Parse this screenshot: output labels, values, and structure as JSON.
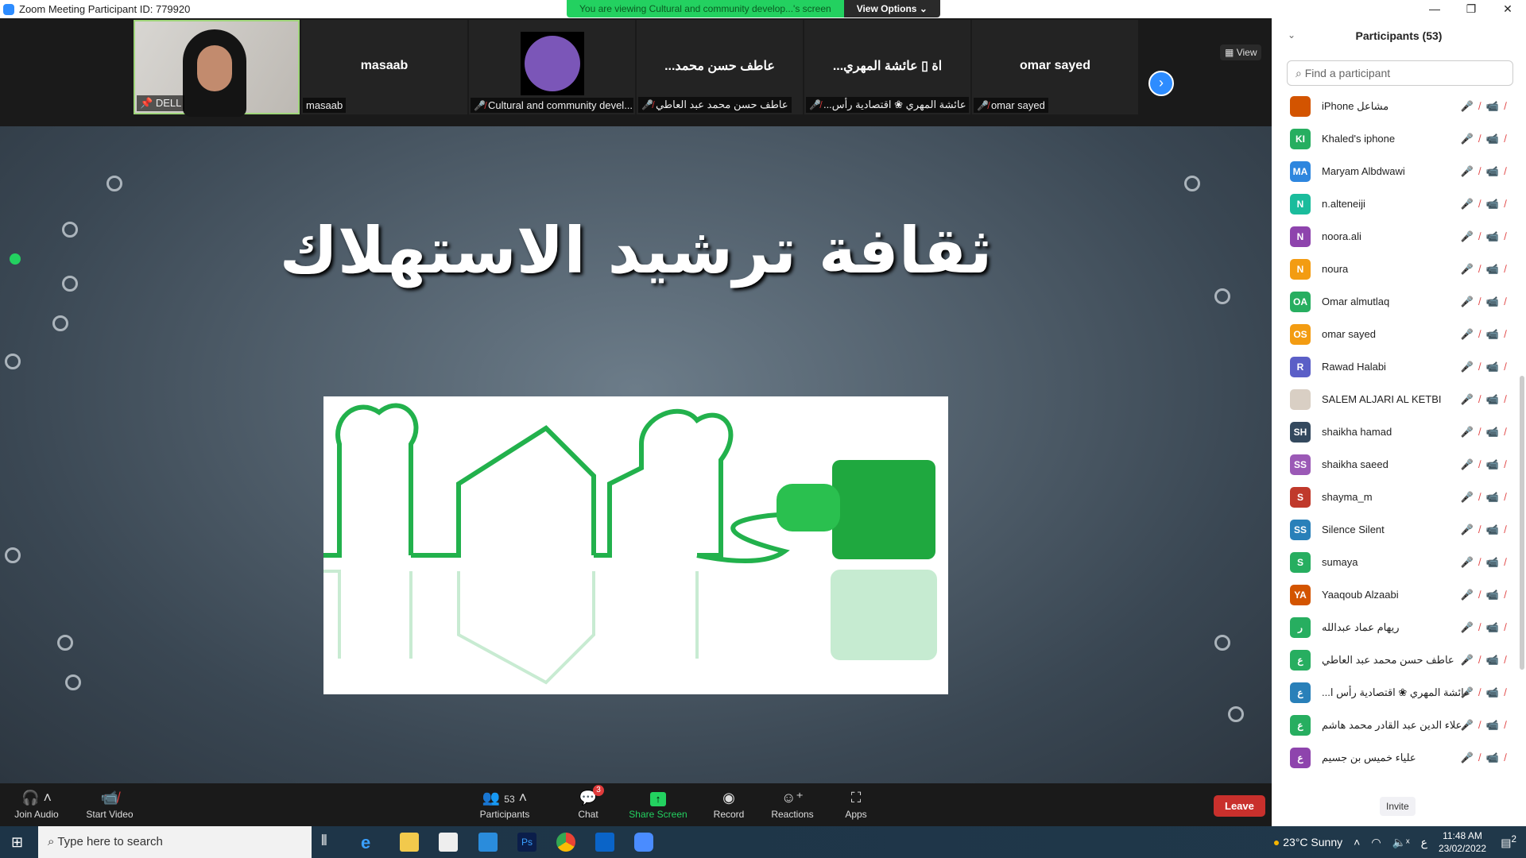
{
  "window": {
    "title": "Zoom Meeting Participant ID: 779920",
    "controls": [
      "—",
      "❐",
      "✕"
    ]
  },
  "banner": {
    "viewing": "You are viewing Cultural and community develop...'s screen",
    "view_options": "View Options ⌄"
  },
  "strip": {
    "view_label": "View",
    "tiles": [
      {
        "name": "",
        "label": "DELL",
        "type": "video"
      },
      {
        "name": "masaab",
        "label": "masaab"
      },
      {
        "name": "",
        "label": "Cultural and community devel...",
        "type": "logo",
        "muted": true
      },
      {
        "name": "...عاطف حسن محمد",
        "label": "عاطف حسن محمد عبد العاطي",
        "muted": true
      },
      {
        "name": "...اة ▯ عائشة المهري",
        "label": "...عائشة المهري ❀ اقتصادية رأس",
        "muted": true
      },
      {
        "name": "omar sayed",
        "label": "omar sayed",
        "muted": true
      }
    ]
  },
  "slide": {
    "title": "ثقافة ترشيد الاستهلاك"
  },
  "toolbar": {
    "join_audio": "Join Audio",
    "start_video": "Start Video",
    "participants": "Participants",
    "participants_count": "53",
    "chat": "Chat",
    "chat_badge": "3",
    "share": "Share Screen",
    "record": "Record",
    "reactions": "Reactions",
    "apps": "Apps",
    "leave": "Leave",
    "share_color": "#23d160"
  },
  "panel": {
    "title": "Participants (53)",
    "search_placeholder": "Find a participant",
    "invite": "Invite",
    "participants": [
      {
        "initials": "",
        "name": "iPhone مشاعل",
        "color": "#d35400"
      },
      {
        "initials": "KI",
        "name": "Khaled's iphone",
        "color": "#27ae60"
      },
      {
        "initials": "MA",
        "name": "Maryam Albdwawi",
        "color": "#2e86de"
      },
      {
        "initials": "N",
        "name": "n.alteneiji",
        "color": "#1abc9c"
      },
      {
        "initials": "N",
        "name": "noora.ali",
        "color": "#8e44ad"
      },
      {
        "initials": "N",
        "name": "noura",
        "color": "#f39c12"
      },
      {
        "initials": "OA",
        "name": "Omar almutlaq",
        "color": "#27ae60"
      },
      {
        "initials": "OS",
        "name": "omar sayed",
        "color": "#f39c12"
      },
      {
        "initials": "R",
        "name": "Rawad Halabi",
        "color": "#5b5fc7"
      },
      {
        "initials": "",
        "name": "SALEM ALJARI AL KETBI",
        "color": "#d9cfc4"
      },
      {
        "initials": "SH",
        "name": "shaikha hamad",
        "color": "#34495e"
      },
      {
        "initials": "SS",
        "name": "shaikha saeed",
        "color": "#9b59b6"
      },
      {
        "initials": "S",
        "name": "shayma_m",
        "color": "#c0392b"
      },
      {
        "initials": "SS",
        "name": "Silence Silent",
        "color": "#2980b9"
      },
      {
        "initials": "S",
        "name": "sumaya",
        "color": "#27ae60"
      },
      {
        "initials": "YA",
        "name": "Yaaqoub Alzaabi",
        "color": "#d35400"
      },
      {
        "initials": "ر",
        "name": "ريهام عماد عبدالله",
        "color": "#27ae60"
      },
      {
        "initials": "ع",
        "name": "عاطف حسن محمد عبد العاطي",
        "color": "#27ae60"
      },
      {
        "initials": "ع",
        "name": "...عائشة المهري ❀ اقتصادية رأس ا",
        "color": "#2980b9"
      },
      {
        "initials": "ع",
        "name": "علاء الدين عبد القادر محمد هاشم",
        "color": "#27ae60"
      },
      {
        "initials": "ع",
        "name": "علياء خميس بن جسيم",
        "color": "#8e44ad"
      }
    ]
  },
  "taskbar": {
    "search_placeholder": "Type here to search",
    "weather": "23°C  Sunny",
    "lang": "ع",
    "time": "11:48 AM",
    "date": "23/02/2022",
    "notifications": "2"
  }
}
